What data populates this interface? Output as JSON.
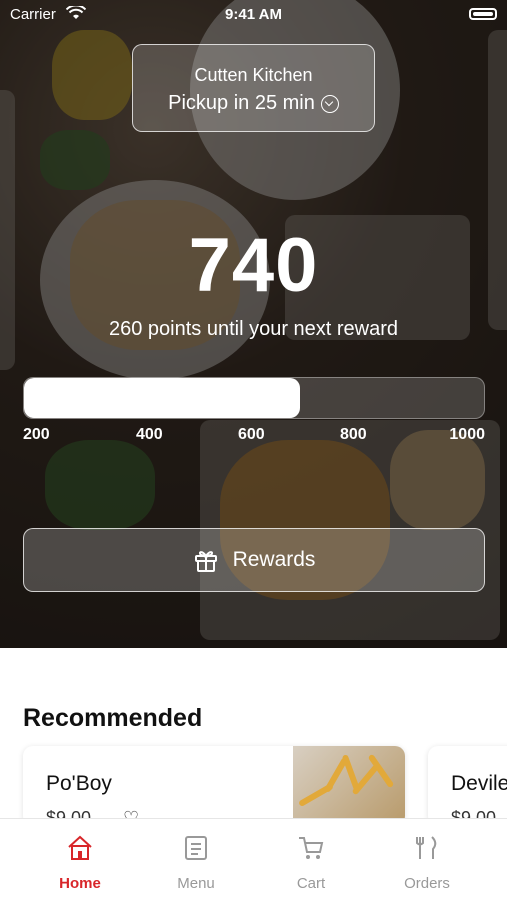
{
  "status_bar": {
    "carrier": "Carrier",
    "time": "9:41 AM"
  },
  "location": {
    "name": "Cutten Kitchen",
    "pickup": "Pickup in 25 min"
  },
  "rewards_summary": {
    "points": "740",
    "until_text": "260 points until your next reward",
    "progress": 0.6,
    "ticks": [
      "200",
      "400",
      "600",
      "800",
      "1000"
    ]
  },
  "rewards_button": {
    "label": "Rewards",
    "icon": "gift-icon"
  },
  "recommended": {
    "title": "Recommended",
    "items": [
      {
        "name": "Po'Boy",
        "price": "$9.00"
      },
      {
        "name": "Deviled",
        "price": "$9.00"
      }
    ]
  },
  "tabbar": {
    "tabs": [
      {
        "label": "Home",
        "icon": "home-icon",
        "active": true
      },
      {
        "label": "Menu",
        "icon": "menu-book-icon",
        "active": false
      },
      {
        "label": "Cart",
        "icon": "cart-icon",
        "active": false
      },
      {
        "label": "Orders",
        "icon": "fork-knife-icon",
        "active": false
      }
    ]
  },
  "colors": {
    "accent": "#d8262a",
    "inactive": "#999999"
  }
}
